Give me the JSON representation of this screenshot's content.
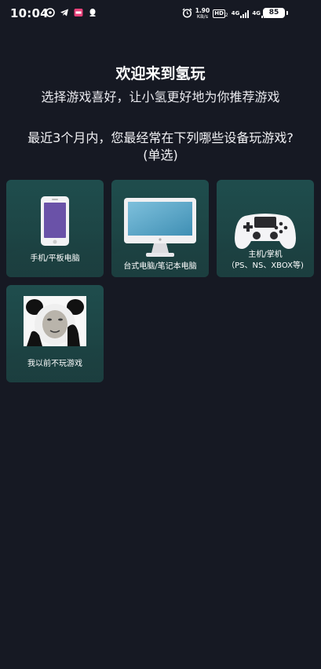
{
  "status_bar": {
    "time": "10:04",
    "net_speed_value": "1.90",
    "net_speed_unit": "KB/s",
    "hd_label": "HD",
    "hd_sub": "2",
    "signal1_label": "4G",
    "signal2_label": "4G",
    "battery": "85"
  },
  "header": {
    "title": "欢迎来到氢玩",
    "subtitle": "选择游戏喜好，让小氢更好地为你推荐游戏"
  },
  "question": {
    "line1": "最近3个月内，您最经常在下列哪些设备玩游戏?",
    "line2": "(单选)"
  },
  "options": [
    {
      "label": "手机/平板电脑",
      "icon": "phone-icon"
    },
    {
      "label": "台式电脑/笔记本电脑",
      "icon": "monitor-icon"
    },
    {
      "label": "主机/掌机",
      "label2": "（PS、NS、XBOX等)",
      "icon": "gamepad-icon"
    },
    {
      "label": "我以前不玩游戏",
      "icon": "meme-panda-icon"
    }
  ],
  "colors": {
    "background": "#161923",
    "card": "#1f4d4d",
    "phone_screen": "#6a52a8"
  }
}
